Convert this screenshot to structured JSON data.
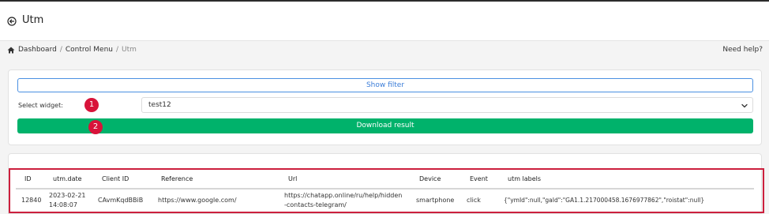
{
  "header": {
    "title": "Utm"
  },
  "breadcrumb": {
    "items": [
      "Dashboard",
      "Control Menu",
      "Utm"
    ],
    "separator": "/"
  },
  "help": {
    "label": "Need help?"
  },
  "filter": {
    "show_filter_label": "Show filter",
    "select_widget_label": "Select widget:",
    "selected_widget": "test12",
    "download_label": "Download result"
  },
  "markers": [
    "1",
    "2"
  ],
  "table": {
    "columns": [
      "ID",
      "utm.date",
      "Client ID",
      "Reference",
      "Url",
      "Device",
      "Event",
      "utm labels"
    ],
    "rows": [
      {
        "id": "12840",
        "date_line1": "2023-02-21",
        "date_line2": "14:08:07",
        "client_id": "CAvmKqdBBiB",
        "reference": "https://www.google.com/",
        "url_line1": "https://chatapp.online/ru/help/hidden",
        "url_line2": "-contacts-telegram/",
        "device": "smartphone",
        "event": "click",
        "utm_labels": "{\"ymId\":null,\"gaId\":\"GA1.1.217000458.1676977862\",\"roistat\":null}"
      }
    ]
  },
  "colors": {
    "primary": "#00b26b",
    "link": "#3b7dd8",
    "highlight": "#cc1f3d",
    "marker": "#d8133a"
  }
}
